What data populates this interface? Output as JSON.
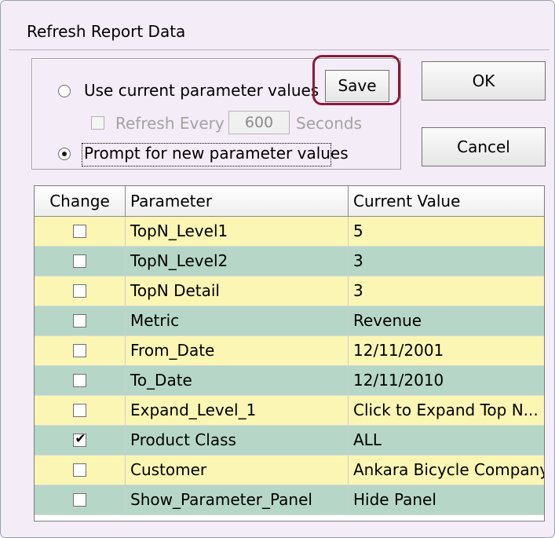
{
  "window": {
    "title": "Refresh Report Data"
  },
  "options": {
    "use_current_label": "Use current parameter values",
    "use_current_selected": false,
    "refresh_every_label": "Refresh Every",
    "refresh_every_checked": false,
    "refresh_interval": "600",
    "seconds_label": "Seconds",
    "prompt_new_label": "Prompt for new parameter values",
    "prompt_new_selected": true
  },
  "buttons": {
    "save": "Save",
    "ok": "OK",
    "cancel": "Cancel"
  },
  "table": {
    "columns": [
      "Change",
      "Parameter",
      "Current Value"
    ],
    "rows": [
      {
        "checked": false,
        "parameter": "TopN_Level1",
        "value": "5",
        "color": "#fbf6b4"
      },
      {
        "checked": false,
        "parameter": "TopN_Level2",
        "value": "3",
        "color": "#b6d7c7"
      },
      {
        "checked": false,
        "parameter": "TopN Detail",
        "value": "3",
        "color": "#fbf6b4"
      },
      {
        "checked": false,
        "parameter": "Metric",
        "value": "Revenue",
        "color": "#b6d7c7"
      },
      {
        "checked": false,
        "parameter": "From_Date",
        "value": "12/11/2001",
        "color": "#fbf6b4"
      },
      {
        "checked": false,
        "parameter": "To_Date",
        "value": "12/11/2010",
        "color": "#b6d7c7"
      },
      {
        "checked": false,
        "parameter": "Expand_Level_1",
        "value": "Click to Expand Top N...",
        "color": "#fbf6b4"
      },
      {
        "checked": true,
        "parameter": "Product Class",
        "value": "ALL",
        "color": "#b6d7c7"
      },
      {
        "checked": false,
        "parameter": "Customer",
        "value": "Ankara Bicycle Company",
        "color": "#fbf6b4"
      },
      {
        "checked": false,
        "parameter": "Show_Parameter_Panel",
        "value": "Hide Panel",
        "color": "#b6d7c7"
      }
    ]
  },
  "colors": {
    "highlight": "#8a1a3b",
    "row_yellow": "#fbf6b4",
    "row_green": "#b6d7c7"
  }
}
